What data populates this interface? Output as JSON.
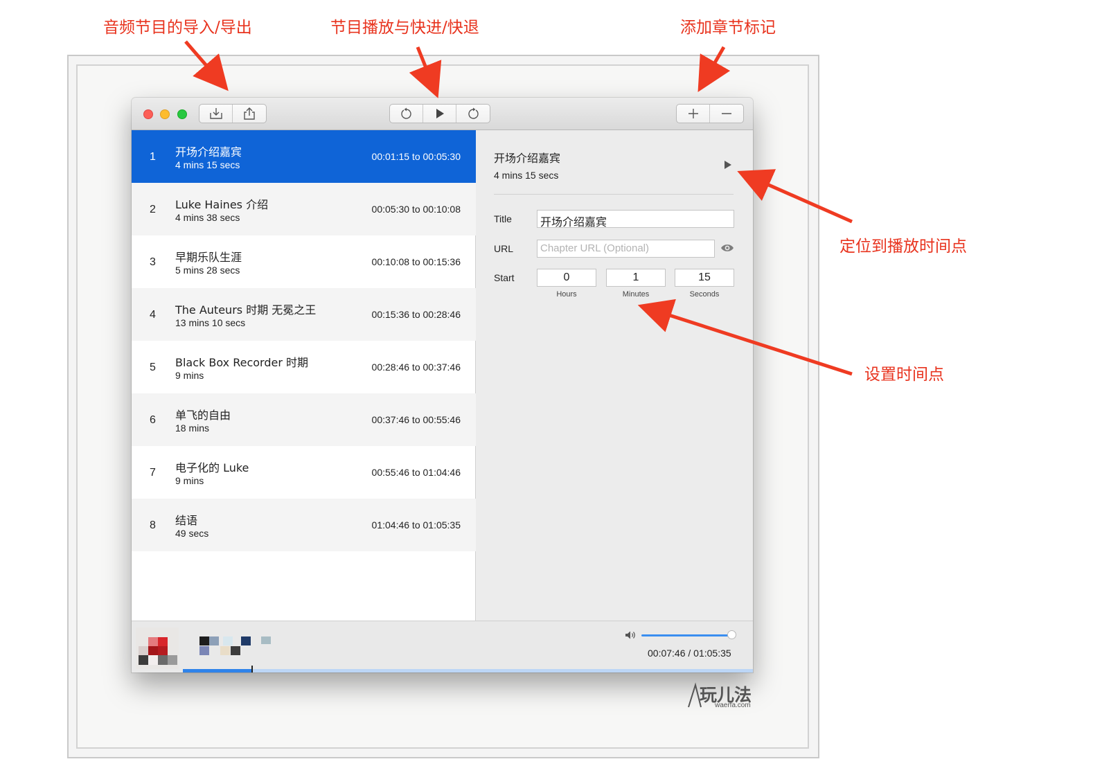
{
  "annotations": {
    "import_export": "音频节目的导入/导出",
    "playback": "节目播放与快进/快退",
    "add_chapter": "添加章节标记",
    "seek": "定位到播放时间点",
    "set_time": "设置时间点"
  },
  "toolbar": {
    "import_icon": "import-tray-icon",
    "export_icon": "share-icon",
    "rewind_icon": "rewind-icon",
    "play_icon": "play-icon",
    "forward_icon": "forward-icon",
    "add_icon": "plus-icon",
    "remove_icon": "minus-icon"
  },
  "chapters": [
    {
      "num": "1",
      "title": "开场介绍嘉宾",
      "duration": "4 mins 15 secs",
      "range": "00:01:15 to 00:05:30"
    },
    {
      "num": "2",
      "title": "Luke Haines 介绍",
      "duration": "4 mins 38 secs",
      "range": "00:05:30 to 00:10:08"
    },
    {
      "num": "3",
      "title": "早期乐队生涯",
      "duration": "5 mins 28 secs",
      "range": "00:10:08 to 00:15:36"
    },
    {
      "num": "4",
      "title": "The Auteurs 时期 无冕之王",
      "duration": "13 mins 10 secs",
      "range": "00:15:36 to 00:28:46"
    },
    {
      "num": "5",
      "title": "Black Box Recorder 时期",
      "duration": "9 mins",
      "range": "00:28:46 to 00:37:46"
    },
    {
      "num": "6",
      "title": "单飞的自由",
      "duration": "18 mins",
      "range": "00:37:46 to 00:55:46"
    },
    {
      "num": "7",
      "title": "电子化的 Luke",
      "duration": "9 mins",
      "range": "00:55:46 to 01:04:46"
    },
    {
      "num": "8",
      "title": "结语",
      "duration": "49 secs",
      "range": "01:04:46 to 01:05:35"
    }
  ],
  "detail": {
    "title": "开场介绍嘉宾",
    "duration": "4 mins 15 secs",
    "title_label": "Title",
    "title_value": "开场介绍嘉宾",
    "url_label": "URL",
    "url_placeholder": "Chapter URL (Optional)",
    "start_label": "Start",
    "hours": "0",
    "minutes": "1",
    "seconds": "15",
    "hours_label": "Hours",
    "minutes_label": "Minutes",
    "seconds_label": "Seconds"
  },
  "player": {
    "time": "00:07:46 / 01:05:35",
    "volume": 0.97,
    "progress": 0.12
  },
  "watermark": {
    "big": "玩儿法",
    "small": "waerfa.com"
  },
  "colors": {
    "accent": "#0f64d7",
    "annotation": "#e8331e"
  }
}
